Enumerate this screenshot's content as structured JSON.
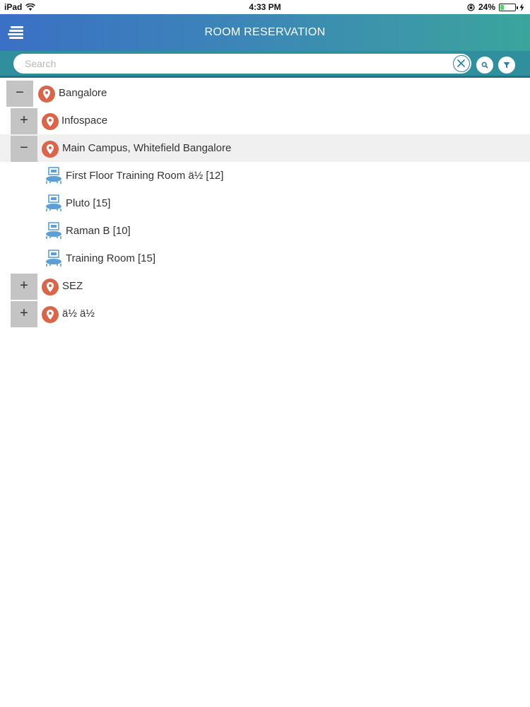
{
  "status_bar": {
    "device": "iPad",
    "time": "4:33 PM",
    "battery": "24%",
    "battery_level": 0.24
  },
  "header": {
    "title": "ROOM RESERVATION"
  },
  "search": {
    "placeholder": "Search",
    "value": ""
  },
  "tree": {
    "bangalore": {
      "toggle": "−",
      "label": "Bangalore"
    },
    "infospace": {
      "toggle": "+",
      "label": "Infospace"
    },
    "main_campus": {
      "toggle": "−",
      "label": "Main Campus, Whitefield Bangalore"
    },
    "rooms": [
      {
        "label": "First Floor Training Room ä½  [12]"
      },
      {
        "label": "Pluto [15]"
      },
      {
        "label": "Raman B [10]"
      },
      {
        "label": "Training Room [15]"
      }
    ],
    "sez": {
      "toggle": "+",
      "label": "SEZ"
    },
    "other": {
      "toggle": "+",
      "label": "ä½  ä½"
    }
  },
  "colors": {
    "header_start": "#3a70c5",
    "header_end": "#3aa59c",
    "search_bar": "#2f8f9c",
    "pin": "#d9654a",
    "room_icon": "#5b9fd6",
    "toggle_bg": "#c4c4c4",
    "highlight_row": "#f0f0f0"
  },
  "icons": {
    "menu": "menu-icon",
    "clear": "close-icon",
    "search": "search-icon",
    "filter": "filter-icon",
    "location": "location-pin-icon",
    "room": "meeting-room-icon"
  }
}
